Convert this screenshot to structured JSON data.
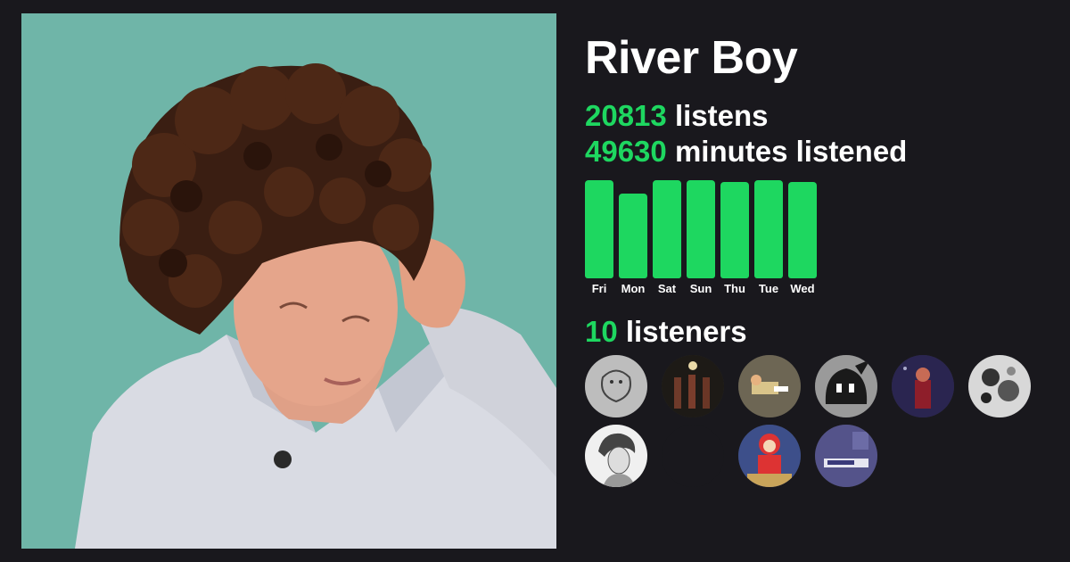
{
  "artist": {
    "name": "River Boy"
  },
  "stats": {
    "listens_count": "20813",
    "listens_label": "listens",
    "minutes_count": "49630",
    "minutes_label": "minutes listened",
    "listeners_count": "10",
    "listeners_label": "listeners"
  },
  "chart_data": {
    "type": "bar",
    "categories": [
      "Fri",
      "Mon",
      "Sat",
      "Sun",
      "Thu",
      "Tue",
      "Wed"
    ],
    "values": [
      1.0,
      0.86,
      1.0,
      1.0,
      0.98,
      1.0,
      0.98
    ],
    "title": "",
    "xlabel": "",
    "ylabel": "",
    "ylim": [
      0,
      1
    ],
    "color": "#1ed760"
  },
  "listeners": [
    {
      "name": "avatar-sketch-bunny"
    },
    {
      "name": "avatar-dark-figures"
    },
    {
      "name": "avatar-lying-figure"
    },
    {
      "name": "avatar-dark-creature"
    },
    {
      "name": "avatar-red-figure"
    },
    {
      "name": "avatar-monochrome-collage"
    },
    {
      "name": "avatar-portrait-sketch"
    },
    {
      "name": "avatar-empty"
    },
    {
      "name": "avatar-red-hood-figure"
    },
    {
      "name": "avatar-purple-room"
    }
  ],
  "colors": {
    "accent": "#1ed760",
    "background": "#19181d",
    "text": "#ffffff"
  }
}
